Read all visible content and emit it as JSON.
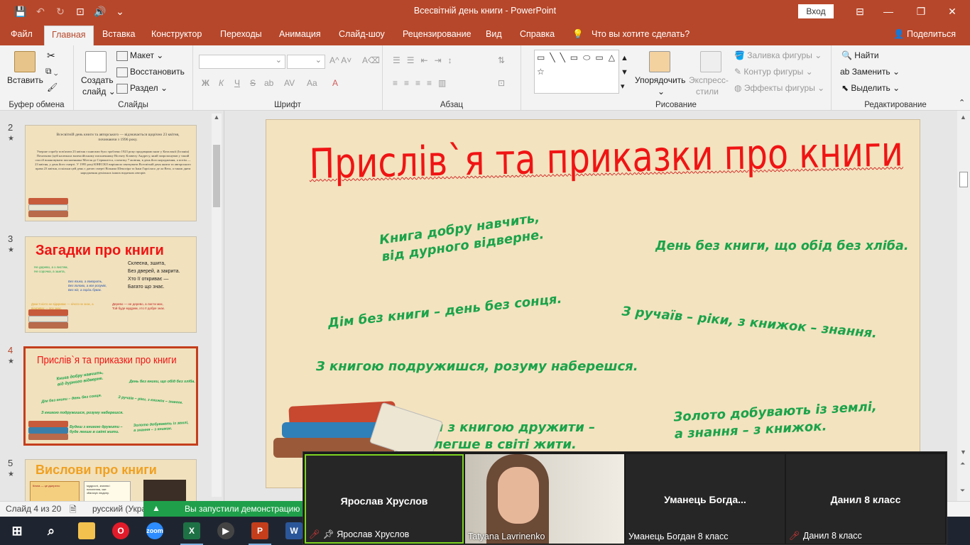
{
  "window": {
    "title": "Всесвітній день книги  -  PowerPoint",
    "signin": "Вход",
    "minimize": "—",
    "restore": "❐",
    "close": "✕"
  },
  "qat": {
    "save": "💾",
    "undo": "↶",
    "redo": "↻",
    "present": "⊡",
    "audio": "🔊",
    "more": "⌄"
  },
  "tabs": [
    {
      "label": "Файл"
    },
    {
      "label": "Главная"
    },
    {
      "label": "Вставка"
    },
    {
      "label": "Конструктор"
    },
    {
      "label": "Переходы"
    },
    {
      "label": "Анимация"
    },
    {
      "label": "Слайд-шоу"
    },
    {
      "label": "Рецензирование"
    },
    {
      "label": "Вид"
    },
    {
      "label": "Справка"
    }
  ],
  "tellme": "Что вы хотите сделать?",
  "share": "Поделиться",
  "ribbon": {
    "clipboard": {
      "label": "Буфер обмена",
      "paste": "Вставить"
    },
    "slides": {
      "label": "Слайды",
      "create_line1": "Создать",
      "create_line2": "слайд",
      "layout": "Макет",
      "reset": "Восстановить",
      "section": "Раздел"
    },
    "font": {
      "label": "Шрифт",
      "bold": "Ж",
      "italic": "К",
      "underline": "Ч",
      "strike": "S",
      "shadow": "ab",
      "spacing": "AV",
      "case": "Aa",
      "color": "A"
    },
    "paragraph": {
      "label": "Абзац"
    },
    "drawing": {
      "label": "Рисование",
      "arrange": "Упорядочить",
      "styles_line1": "Экспресс-",
      "styles_line2": "стили",
      "fill": "Заливка фигуры",
      "outline": "Контур фигуры",
      "effects": "Эффекты фигуры",
      "shapes": "▭╲╲▭⬭▭△⌐⌐⇨⬠⬡⌇⌒⌒{}☆"
    },
    "editing": {
      "label": "Редактирование",
      "find": "Найти",
      "replace": "Заменить",
      "select": "Выделить"
    }
  },
  "thumbnails": [
    {
      "num": "2",
      "star": "★",
      "title": "Всесвітній день книги та авторського — відзначається щорічно 23 квітня, починаючи з 1996 року.",
      "body": "Уперше спробу пов'язати 23 квітня з книгами було зроблено 1923 року продавцями книг у Каталонії (Іспанія) Початково (цей належала валенсійському письменнику Вісенту Клавелу Андресу, який запропонував у такий спосіб вшановувати письменника Мігеля де Сервантеса, спочатку 7 жовтня, в день його народження, а потім — 23 квітня, у день його смерті. У 1995 році ЮНЕСКО вирішило святкувати Всесвітній день книги та авторського права 23 квітня, оскільки цей день є датою смерті Вільяма Шекспіра та Інки Гарсіласо де ла Вега, а також днем народження декількох інших видатних авторів"
    },
    {
      "num": "3",
      "star": "★",
      "title": "Загадки про книги",
      "r1": "Склеєна, зшита,",
      "r2": "Без дверей, а закрита.",
      "r3": "Хто її откриває —",
      "r4": "Багато що знає.",
      "g1": "Не дерево, а з листям,",
      "g2": "Не сорочка, а зшита,",
      "b1": "Без язика, а говорить,",
      "b2": "Без голови, а все розуміє,",
      "b3": "Без ніг, а скрізь буває.",
      "o1": "Доки її ніхто не відкриває — нічого не знає, а відкриває — все знає.",
      "rr1": "Дерево — не дерево, а листи має,",
      "rr2": "Той буде мудрим, хто її добре знає."
    },
    {
      "num": "4",
      "star": "★",
      "title": "Прислів`я  та приказки про книги",
      "p1": "Книга добру навчить,",
      "p2": "від дурного відверне.",
      "p3": "День без книги, що обід без хліба.",
      "p4": "Дім без книги – день без сонця.",
      "p5": "З ручаїв – ріки, з книжок – знання.",
      "p6": "З книгою подружишся, розуму наберешся.",
      "p7": "Будеш з книгою дружити –",
      "p8": "буде легше в світі жити.",
      "p9": "Золото добувають із землі,",
      "p10": "а знання – з книжок."
    },
    {
      "num": "5",
      "star": "★",
      "title": "Вислови про книги",
      "q1": "Книга — це джерело",
      "q2": "мудрості, знання і",
      "q3": "натхнення, яке",
      "q4": "збагачує людину."
    }
  ],
  "slide": {
    "title": "Прислів`я  та приказки про книги",
    "proverbs": {
      "p1a": "Книга добру навчить,",
      "p1b": "від дурного відверне.",
      "p2": "День без книги, що обід без хліба.",
      "p3": "Дім без книги – день без сонця.",
      "p4": "З ручаїв – ріки, з книжок – знання.",
      "p5": "З книгою подружишся, розуму наберешся.",
      "p6a": "Будеш з книгою дружити –",
      "p6b": "буде легше в світі жити.",
      "p7a": "Золото добувають із землі,",
      "p7b": "а знання – з книжок."
    }
  },
  "status": {
    "slide": "Слайд 4 из 20",
    "lang": "русский (Укра",
    "notice": "Вы запустили демонстрацию"
  },
  "zoom": {
    "tiles": [
      {
        "name": "Ярослав Хруслов",
        "label": "Ярослав Хруслов",
        "muted": true
      },
      {
        "name": "",
        "label": "Tatyana Lavrinenko",
        "muted": false
      },
      {
        "name": "Уманець  Богда...",
        "label": "Уманець Богдан 8 класс",
        "muted": false
      },
      {
        "name": "Данил 8 класс",
        "label": "Данил 8 класс",
        "muted": true
      }
    ]
  },
  "taskbar": {
    "start": "⊞",
    "search": "⌕",
    "apps": [
      "Explorer",
      "Opera",
      "Zoom",
      "Excel",
      "Media",
      "PowerPoint",
      "Word"
    ],
    "zoom_text": "zoom",
    "excel_text": "X",
    "ppt_text": "P",
    "word_text": "W",
    "opera_text": "O",
    "media_text": "▶"
  },
  "colors": {
    "accent": "#b7472a",
    "slide_bg": "#f3e3bf",
    "title_red": "#f01414",
    "proverb_green": "#1aa34a",
    "zoom_bg": "#1a1a1a"
  }
}
